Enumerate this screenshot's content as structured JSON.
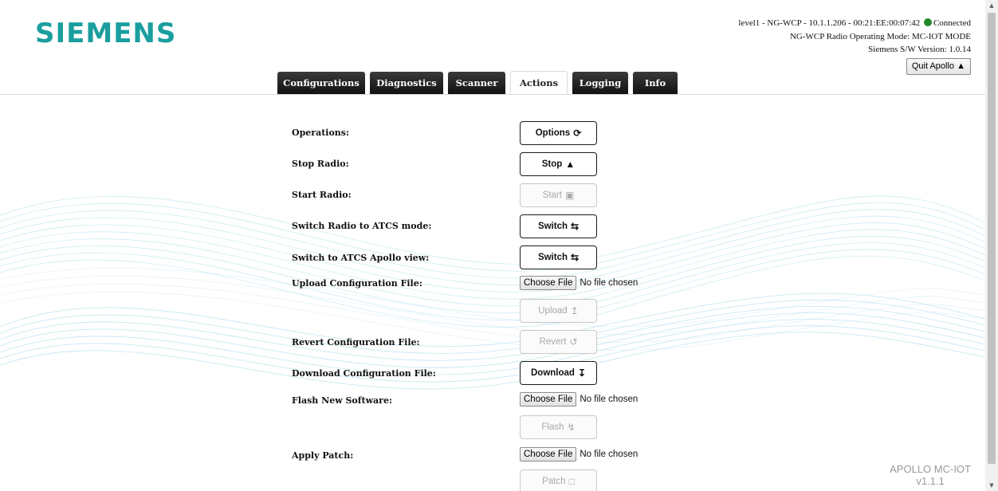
{
  "brand": {
    "logo": "SIEMENS",
    "color": "#1b9e9e"
  },
  "status": {
    "line1": "level1 - NG-WCP - 10.1.1.206 - 00:21:EE:00:07:42",
    "connection": "Connected",
    "connection_color": "#1f8a2a",
    "line2": "NG-WCP Radio Operating Mode: MC-IOT MODE",
    "line3": "Siemens S/W Version: 1.0.14",
    "quit_label": "Quit Apollo",
    "quit_icon": "warning-icon"
  },
  "tabs": [
    {
      "label": "Configurations",
      "active": false
    },
    {
      "label": "Diagnostics",
      "active": false
    },
    {
      "label": "Scanner",
      "active": false
    },
    {
      "label": "Actions",
      "active": true
    },
    {
      "label": "Logging",
      "active": false
    },
    {
      "label": "Info",
      "active": false
    }
  ],
  "actions": {
    "operations": {
      "label": "Operations:",
      "button": "Options",
      "icon": "refresh-icon",
      "enabled": true
    },
    "stop_radio": {
      "label": "Stop Radio:",
      "button": "Stop",
      "icon": "warning-icon",
      "enabled": true
    },
    "start_radio": {
      "label": "Start Radio:",
      "button": "Start",
      "icon": "play-square-icon",
      "enabled": false
    },
    "switch_atcs_mode": {
      "label": "Switch Radio to ATCS mode:",
      "button": "Switch",
      "icon": "retweet-icon",
      "enabled": true
    },
    "switch_atcs_view": {
      "label": "Switch to ATCS Apollo view:",
      "button": "Switch",
      "icon": "retweet-icon",
      "enabled": true
    },
    "upload_config": {
      "label": "Upload Configuration File:",
      "file_button": "Choose File",
      "file_status": "No file chosen",
      "button": "Upload",
      "icon": "upload-icon",
      "enabled": false
    },
    "revert_config": {
      "label": "Revert Configuration File:",
      "button": "Revert",
      "icon": "undo-icon",
      "enabled": false
    },
    "download_config": {
      "label": "Download Configuration File:",
      "button": "Download",
      "icon": "download-icon",
      "enabled": true
    },
    "flash_software": {
      "label": "Flash New Software:",
      "file_button": "Choose File",
      "file_status": "No file chosen",
      "button": "Flash",
      "icon": "bolt-icon",
      "enabled": false
    },
    "apply_patch": {
      "label": "Apply Patch:",
      "file_button": "Choose File",
      "file_status": "No file chosen",
      "button": "Patch",
      "icon": "square-icon",
      "enabled": false
    }
  },
  "footer": {
    "product": "APOLLO MC-IOT",
    "version": "v1.1.1"
  }
}
